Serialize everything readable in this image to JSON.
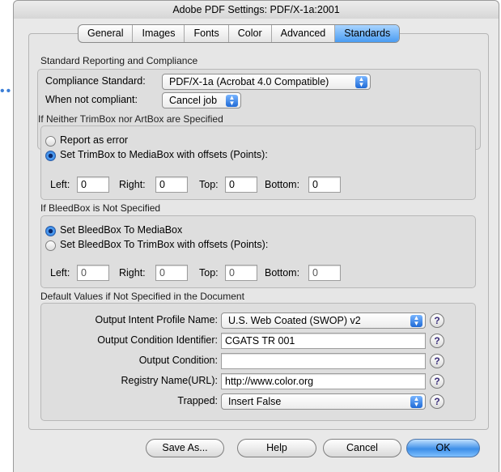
{
  "window": {
    "title": "Adobe PDF Settings: PDF/X-1a:2001"
  },
  "tabs": [
    {
      "label": "General"
    },
    {
      "label": "Images"
    },
    {
      "label": "Fonts"
    },
    {
      "label": "Color"
    },
    {
      "label": "Advanced"
    },
    {
      "label": "Standards"
    }
  ],
  "reporting": {
    "section_title": "Standard Reporting and Compliance",
    "compliance_label": "Compliance Standard:",
    "compliance_value": "PDF/X-1a (Acrobat 4.0 Compatible)",
    "not_compliant_label": "When not compliant:",
    "not_compliant_value": "Cancel job"
  },
  "trimbox": {
    "section_title": "If Neither TrimBox nor ArtBox are Specified",
    "option_report": "Report as error",
    "option_set": "Set TrimBox to MediaBox with offsets (Points):",
    "left_label": "Left:",
    "left_value": "0",
    "right_label": "Right:",
    "right_value": "0",
    "top_label": "Top:",
    "top_value": "0",
    "bottom_label": "Bottom:",
    "bottom_value": "0"
  },
  "bleedbox": {
    "section_title": "If BleedBox is Not Specified",
    "option_media": "Set BleedBox To MediaBox",
    "option_trim": "Set BleedBox To TrimBox with offsets (Points):",
    "left_label": "Left:",
    "left_value": "0",
    "right_label": "Right:",
    "right_value": "0",
    "top_label": "Top:",
    "top_value": "0",
    "bottom_label": "Bottom:",
    "bottom_value": "0"
  },
  "defaults": {
    "section_title": "Default Values if Not Specified in the Document",
    "profile_label": "Output Intent Profile Name:",
    "profile_value": "U.S. Web Coated (SWOP) v2",
    "identifier_label": "Output Condition Identifier:",
    "identifier_value": "CGATS TR 001",
    "condition_label": "Output Condition:",
    "condition_value": "",
    "registry_label": "Registry Name(URL):",
    "registry_value": "http://www.color.org",
    "trapped_label": "Trapped:",
    "trapped_value": "Insert False",
    "help_glyph": "?"
  },
  "buttons": {
    "save_as": "Save As...",
    "help": "Help",
    "cancel": "Cancel",
    "ok": "OK"
  },
  "colors": {
    "accent": "#4a9cf2",
    "help_text": "#3a2d7a"
  }
}
